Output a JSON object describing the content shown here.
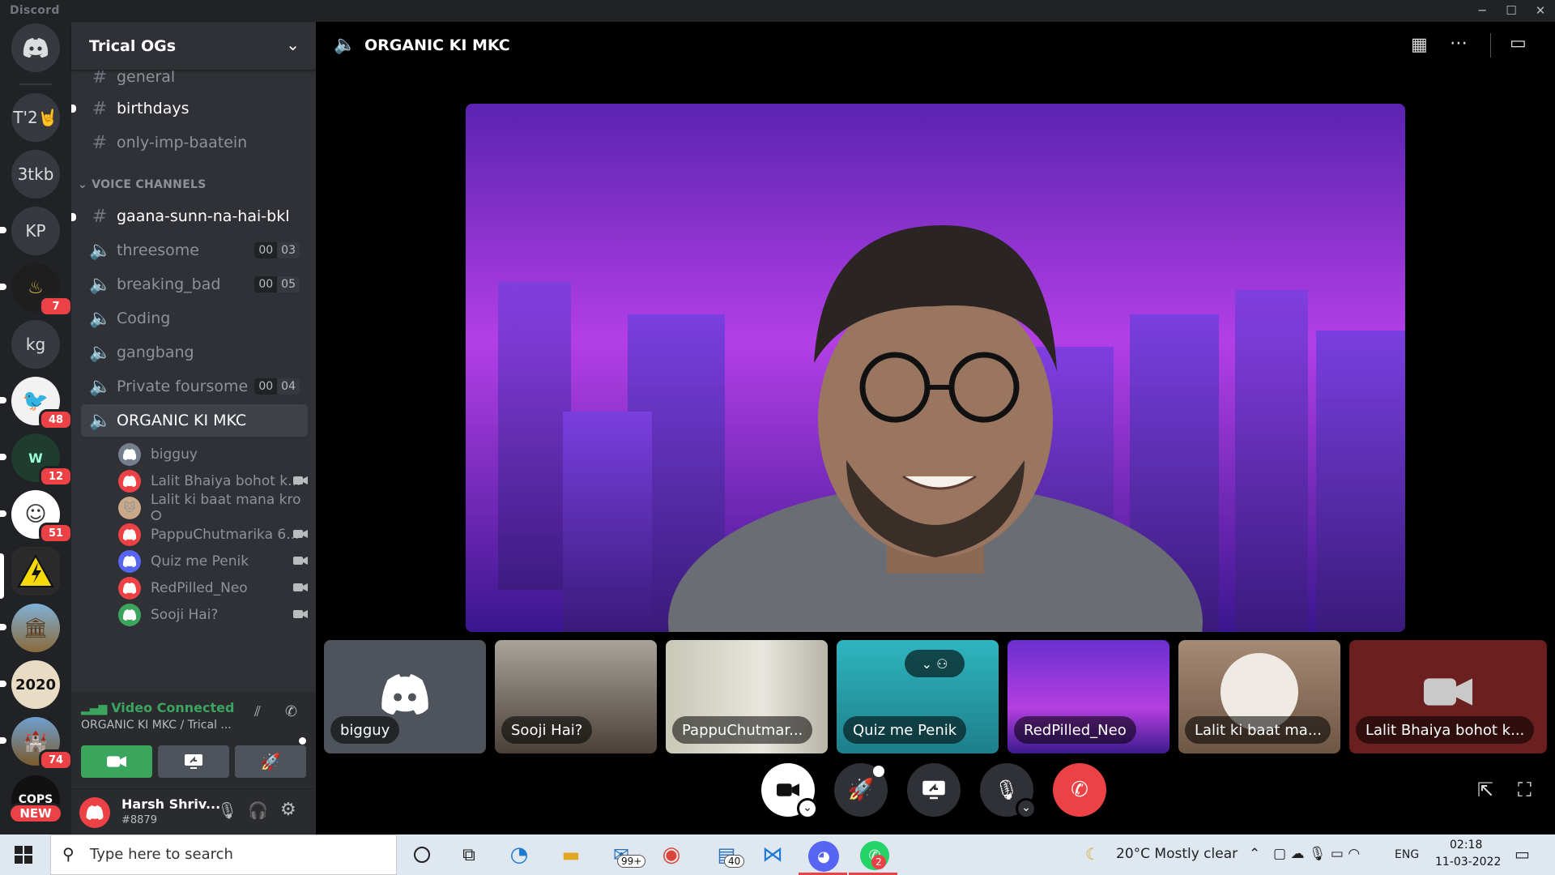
{
  "window": {
    "app_name": "Discord"
  },
  "server": {
    "name": "Trical OGs"
  },
  "channels": [
    {
      "name": "general"
    },
    {
      "name": "birthdays"
    },
    {
      "name": "only-imp-baatein"
    }
  ],
  "voice_category": "VOICE CHANNELS",
  "voice_channels": [
    {
      "name": "gaana-sunn-na-hai-bkl"
    },
    {
      "name": "threesome",
      "count_a": "00",
      "count_b": "03"
    },
    {
      "name": "breaking_bad",
      "count_a": "00",
      "count_b": "05"
    },
    {
      "name": "Coding"
    },
    {
      "name": "gangbang"
    },
    {
      "name": "Private foursome",
      "count_a": "00",
      "count_b": "04"
    },
    {
      "name": "ORGANIC KI MKC"
    }
  ],
  "voice_users": [
    {
      "name": "bigguy"
    },
    {
      "name": "Lalit Bhaiya bohot k..."
    },
    {
      "name": "Lalit ki baat mana kro ⭘"
    },
    {
      "name": "PappuChutmarika 6..."
    },
    {
      "name": "Quiz me Penik"
    },
    {
      "name": "RedPilled_Neo"
    },
    {
      "name": "Sooji Hai?"
    }
  ],
  "guilds": [
    {
      "label": "T'2🤘"
    },
    {
      "label": "3tkb"
    },
    {
      "label": "KP"
    },
    {
      "label": "kg"
    },
    {
      "label": "2020"
    }
  ],
  "guild_badges": [
    "7",
    "48",
    "12",
    "51",
    "74"
  ],
  "new_badge": "NEW",
  "voice_connection": {
    "status": "Video Connected",
    "location": "ORGANIC KI MKC / Trical ..."
  },
  "user": {
    "name": "Harsh Shriv...",
    "tag": "#8879"
  },
  "stage": {
    "title": "ORGANIC KI MKC"
  },
  "participants": [
    "bigguy",
    "Sooji Hai?",
    "PappuChutmar...",
    "Quiz me Penik",
    "RedPilled_Neo",
    "Lalit ki baat ma...",
    "Lalit Bhaiya bohot k..."
  ],
  "taskbar": {
    "search_placeholder": "Type here to search",
    "mail_badge": "99+",
    "files_badge": "40",
    "whatsapp_badge": "2",
    "weather": "20°C  Mostly clear",
    "lang": "ENG",
    "time": "02:18",
    "date": "11-03-2022"
  },
  "colors": {
    "accent": "#5865f2",
    "green": "#3ba55d",
    "red": "#ed4245",
    "brand_red": "#ed4245"
  }
}
